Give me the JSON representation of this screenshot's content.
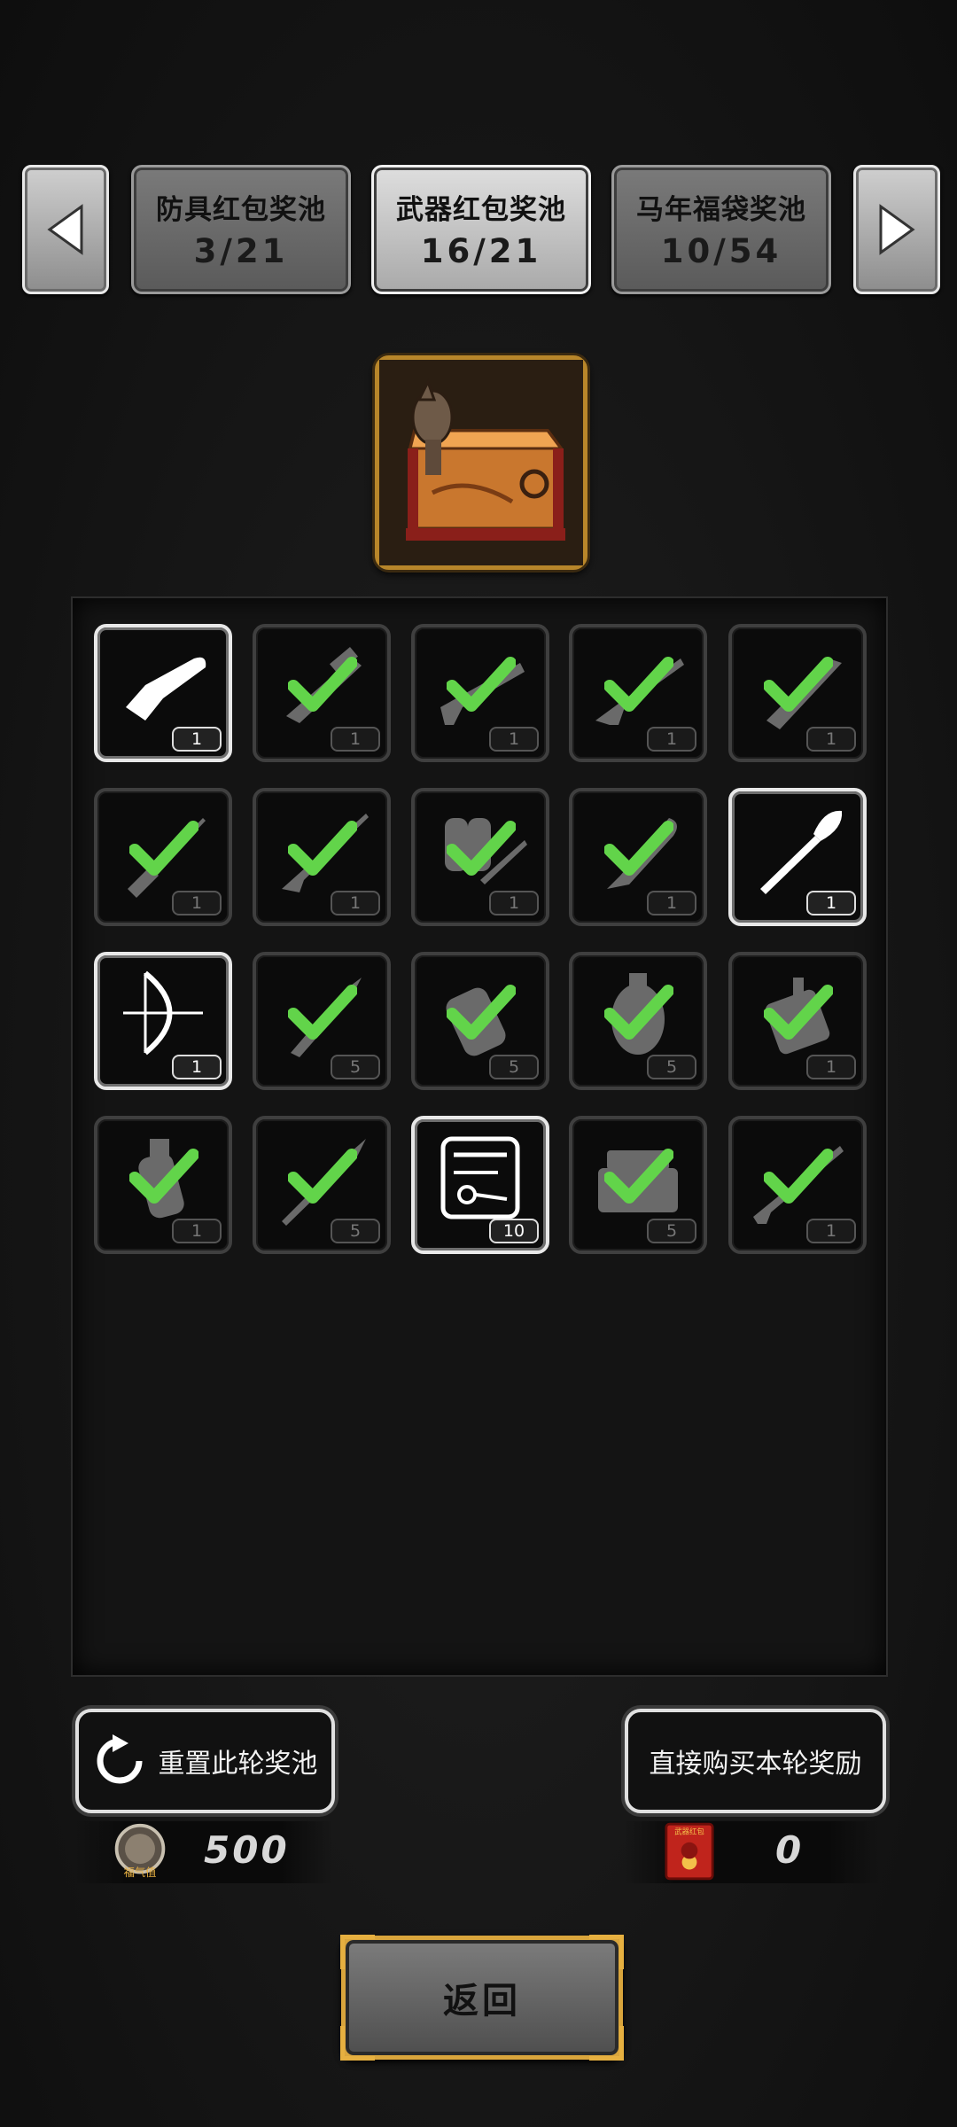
{
  "tabs": {
    "prev_arrow": "left-arrow",
    "next_arrow": "right-arrow",
    "items": [
      {
        "name": "防具红包奖池",
        "count": "3/21"
      },
      {
        "name": "武器红包奖池",
        "count": "16/21"
      },
      {
        "name": "马年福袋奖池",
        "count": "10/54"
      }
    ],
    "active_index": 1
  },
  "pool_icon": "horse-treasure-chest",
  "items": [
    {
      "icon": "chainsaw",
      "qty": "1",
      "collected": false
    },
    {
      "icon": "minigun",
      "qty": "1",
      "collected": true
    },
    {
      "icon": "shotgun",
      "qty": "1",
      "collected": true
    },
    {
      "icon": "assault-rifle",
      "qty": "1",
      "collected": true
    },
    {
      "icon": "sword",
      "qty": "1",
      "collected": true
    },
    {
      "icon": "screwdriver",
      "qty": "1",
      "collected": true
    },
    {
      "icon": "bayonet-rifle",
      "qty": "1",
      "collected": true
    },
    {
      "icon": "flamethrower",
      "qty": "1",
      "collected": true
    },
    {
      "icon": "machete",
      "qty": "1",
      "collected": true
    },
    {
      "icon": "shovel",
      "qty": "1",
      "collected": false
    },
    {
      "icon": "compound-bow",
      "qty": "1",
      "collected": false
    },
    {
      "icon": "spear-tip",
      "qty": "5",
      "collected": true
    },
    {
      "icon": "brass-knuckle",
      "qty": "5",
      "collected": true
    },
    {
      "icon": "grenade",
      "qty": "5",
      "collected": true
    },
    {
      "icon": "bundle-explosive",
      "qty": "1",
      "collected": true
    },
    {
      "icon": "frag-grenade",
      "qty": "1",
      "collected": true
    },
    {
      "icon": "spear",
      "qty": "5",
      "collected": true
    },
    {
      "icon": "tool-kit",
      "qty": "10",
      "collected": false
    },
    {
      "icon": "toolbox",
      "qty": "5",
      "collected": true
    },
    {
      "icon": "rocket-launcher",
      "qty": "1",
      "collected": true
    }
  ],
  "actions": {
    "reset_label": "重置此轮奖池",
    "buy_label": "直接购买本轮奖励"
  },
  "currency": {
    "luck_label": "福气值",
    "luck_value": "500",
    "packet_label": "武器红包",
    "packet_value": "0"
  },
  "back_label": "返回",
  "colors": {
    "check": "#62d44a",
    "gold": "#d9a53c"
  }
}
